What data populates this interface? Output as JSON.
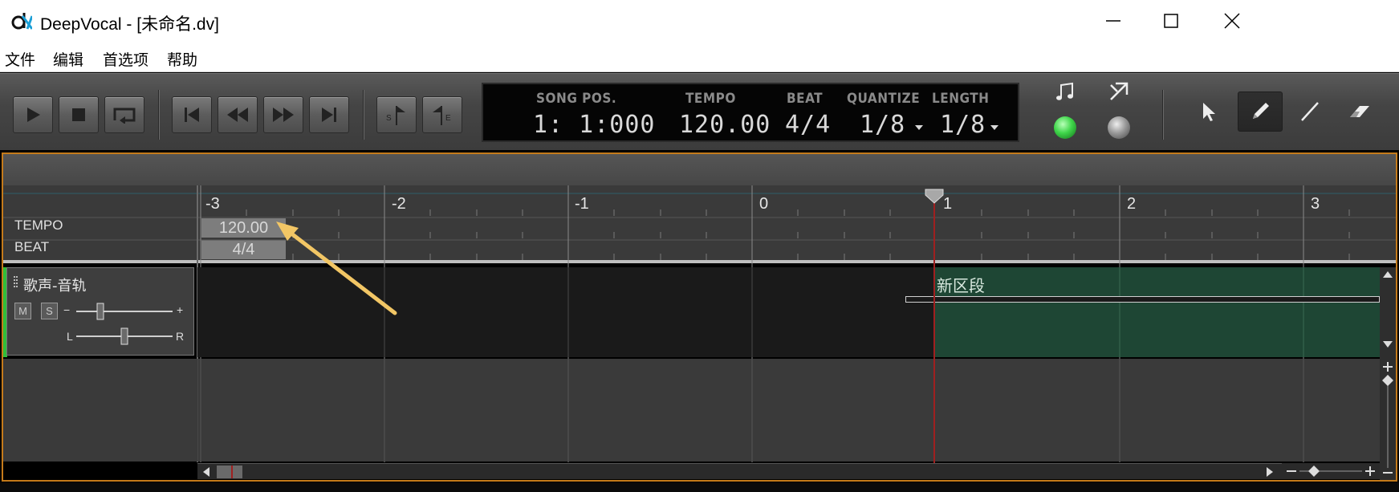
{
  "window": {
    "title": "DeepVocal - [未命名.dv]",
    "controls": [
      "minimize-icon",
      "maximize-icon",
      "close-icon"
    ]
  },
  "menu": [
    "文件",
    "编辑",
    "首选项",
    "帮助"
  ],
  "transport": {
    "buttons": [
      "play-icon",
      "stop-icon",
      "loop-icon",
      "skip-start-icon",
      "rewind-icon",
      "fast-forward-icon",
      "skip-end-icon",
      "snap-start-icon",
      "snap-end-icon"
    ]
  },
  "lcd": {
    "song_pos_label": "SONG POS.",
    "song_pos_value": "1: 1:000",
    "tempo_label": "TEMPO",
    "tempo_value": "120.00",
    "beat_label": "BEAT",
    "beat_value": "4/4",
    "quantize_label": "QUANTIZE",
    "quantize_value": "1/8",
    "length_label": "LENGTH",
    "length_value": "1/8"
  },
  "indicators": {
    "metronome_icon": "music-note-icon",
    "metronome_active_color": "#3fd64a",
    "autoscroll_icon": "auto-scroll-icon"
  },
  "tools": [
    "pointer-icon",
    "pencil-icon",
    "line-icon",
    "eraser-icon"
  ],
  "ruler": {
    "bars": [
      "-3",
      "-2",
      "-1",
      "0",
      "1",
      "2",
      "3"
    ],
    "tempo_label": "TEMPO",
    "beat_label": "BEAT",
    "tempo_marker": "120.00",
    "beat_marker": "4/4"
  },
  "track": {
    "name": "歌声-音轨",
    "mute": "M",
    "solo": "S",
    "vol_minus": "−",
    "vol_plus": "+",
    "pan_left": "L",
    "pan_right": "R",
    "segment_name": "新区段"
  },
  "colors": {
    "accent_frame": "#c47a1a",
    "segment_fill": "#1e4634",
    "playhead": "#a02020",
    "annotation_arrow": "#f2c665"
  }
}
